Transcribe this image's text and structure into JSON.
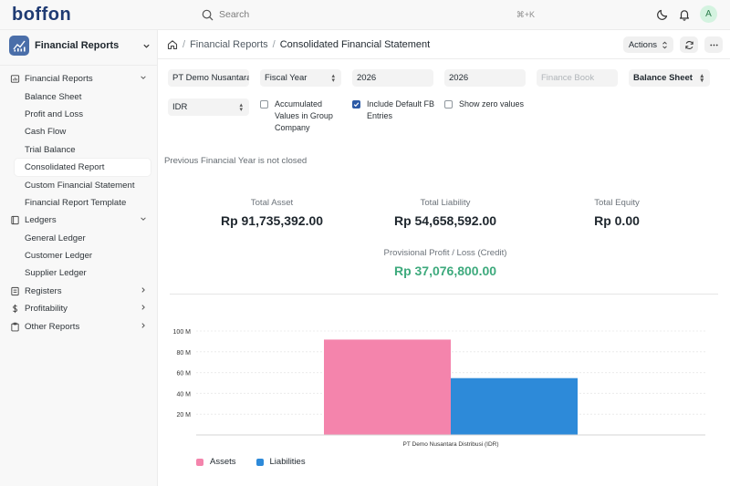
{
  "brand": {
    "logo": "boffon"
  },
  "search": {
    "placeholder": "Search",
    "shortcut": "⌘+K"
  },
  "user": {
    "avatar_initial": "A"
  },
  "workspace": {
    "title": "Financial Reports"
  },
  "sidebar": {
    "items": [
      {
        "type": "group",
        "label": "Financial Reports",
        "icon": "report-icon",
        "chevron": "down"
      },
      {
        "type": "child",
        "label": "Balance Sheet"
      },
      {
        "type": "child",
        "label": "Profit and Loss"
      },
      {
        "type": "child",
        "label": "Cash Flow"
      },
      {
        "type": "child",
        "label": "Trial Balance"
      },
      {
        "type": "child",
        "label": "Consolidated Report",
        "active": true
      },
      {
        "type": "child",
        "label": "Custom Financial Statement"
      },
      {
        "type": "child",
        "label": "Financial Report Template"
      },
      {
        "type": "group",
        "label": "Ledgers",
        "icon": "ledger-icon",
        "chevron": "down"
      },
      {
        "type": "child",
        "label": "General Ledger"
      },
      {
        "type": "child",
        "label": "Customer Ledger"
      },
      {
        "type": "child",
        "label": "Supplier Ledger"
      },
      {
        "type": "group",
        "label": "Registers",
        "icon": "register-icon",
        "chevron": "right"
      },
      {
        "type": "group",
        "label": "Profitability",
        "icon": "dollar-icon",
        "chevron": "right"
      },
      {
        "type": "group",
        "label": "Other Reports",
        "icon": "clipboard-icon",
        "chevron": "right"
      }
    ]
  },
  "breadcrumb": {
    "parent": "Financial Reports",
    "current": "Consolidated Financial Statement"
  },
  "actions": {
    "label": "Actions"
  },
  "filters": {
    "company": "PT Demo Nusantara Distribusi",
    "period_type": "Fiscal Year",
    "from_year": "2026",
    "to_year": "2026",
    "finance_book_placeholder": "Finance Book",
    "report": "Balance Sheet",
    "currency": "IDR",
    "accumulated": {
      "label": "Accumulated Values in Group Company",
      "checked": false
    },
    "include_default_fb": {
      "label": "Include Default FB Entries",
      "checked": true
    },
    "show_zero": {
      "label": "Show zero values",
      "checked": false
    }
  },
  "notice": "Previous Financial Year is not closed",
  "summary": {
    "total_asset": {
      "label": "Total Asset",
      "value": "Rp 91,735,392.00"
    },
    "total_liability": {
      "label": "Total Liability",
      "value": "Rp 54,658,592.00"
    },
    "total_equity": {
      "label": "Total Equity",
      "value": "Rp 0.00"
    },
    "provisional": {
      "label": "Provisional Profit / Loss (Credit)",
      "value": "Rp 37,076,800.00"
    }
  },
  "colors": {
    "assets": "#f484ac",
    "liabilities": "#2d8ad9",
    "positive": "#3eaa7d"
  },
  "chart_data": {
    "type": "bar",
    "categories": [
      "PT Demo Nusantara Distribusi (IDR)"
    ],
    "series": [
      {
        "name": "Assets",
        "values": [
          91735392
        ]
      },
      {
        "name": "Liabilities",
        "values": [
          54658592
        ]
      }
    ],
    "yticks": [
      "20 M",
      "40 M",
      "60 M",
      "80 M",
      "100 M"
    ],
    "ylim": [
      0,
      100000000
    ],
    "grid": true,
    "legend": "bottom-left"
  }
}
